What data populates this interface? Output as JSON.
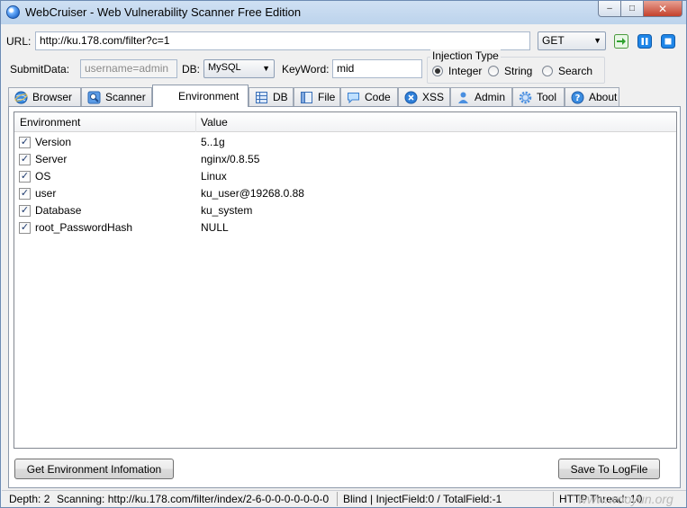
{
  "window": {
    "title": "WebCruiser - Web Vulnerability Scanner Free Edition",
    "min_glyph": "–",
    "max_glyph": "□",
    "close_glyph": "✕"
  },
  "toolbar": {
    "url_label": "URL:",
    "url_value": "http://ku.178.com/filter?c=1",
    "method": "GET",
    "submit_label": "SubmitData:",
    "submit_placeholder": "username=admin",
    "db_label": "DB:",
    "db_value": "MySQL",
    "keyword_label": "KeyWord:",
    "keyword_value": "mid"
  },
  "injection": {
    "title": "Injection Type",
    "options": [
      "Integer",
      "String",
      "Search"
    ],
    "selected": "Integer"
  },
  "tabs": [
    {
      "label": "Browser",
      "icon": "browser-icon"
    },
    {
      "label": "Scanner",
      "icon": "scanner-icon"
    },
    {
      "label": "Environment",
      "icon": ""
    },
    {
      "label": "DB",
      "icon": "db-icon"
    },
    {
      "label": "File",
      "icon": "file-icon"
    },
    {
      "label": "Code",
      "icon": "code-icon"
    },
    {
      "label": "XSS",
      "icon": "xss-icon"
    },
    {
      "label": "Admin",
      "icon": "admin-icon"
    },
    {
      "label": "Tool",
      "icon": "tool-icon"
    },
    {
      "label": "About",
      "icon": "about-icon"
    }
  ],
  "active_tab": "Environment",
  "table": {
    "col_name": "Environment",
    "col_value": "Value",
    "check_glyph": "✓",
    "rows": [
      {
        "name": "Version",
        "value": "5..1g",
        "checked": true
      },
      {
        "name": "Server",
        "value": "nginx/0.8.55",
        "checked": true
      },
      {
        "name": "OS",
        "value": "Linux",
        "checked": true
      },
      {
        "name": "user",
        "value": "ku_user@19268.0.88",
        "checked": true
      },
      {
        "name": "Database",
        "value": "ku_system",
        "checked": true
      },
      {
        "name": "root_PasswordHash",
        "value": "NULL",
        "checked": true
      }
    ]
  },
  "buttons": {
    "get_env": "Get Environment Infomation",
    "save_log": "Save To LogFile"
  },
  "status": {
    "depth": "Depth: 2",
    "scanning": "Scanning: http://ku.178.com/filter/index/2-6-0-0-0-0-0-0-0",
    "blind": "Blind | InjectField:0 / TotalField:-1",
    "thread": "HTTP Thread: 10",
    "watermark": "www.wooyun.org"
  },
  "colors": {
    "go": "#2fa12f",
    "pause": "#1f86e8",
    "stop": "#1f86e8"
  }
}
